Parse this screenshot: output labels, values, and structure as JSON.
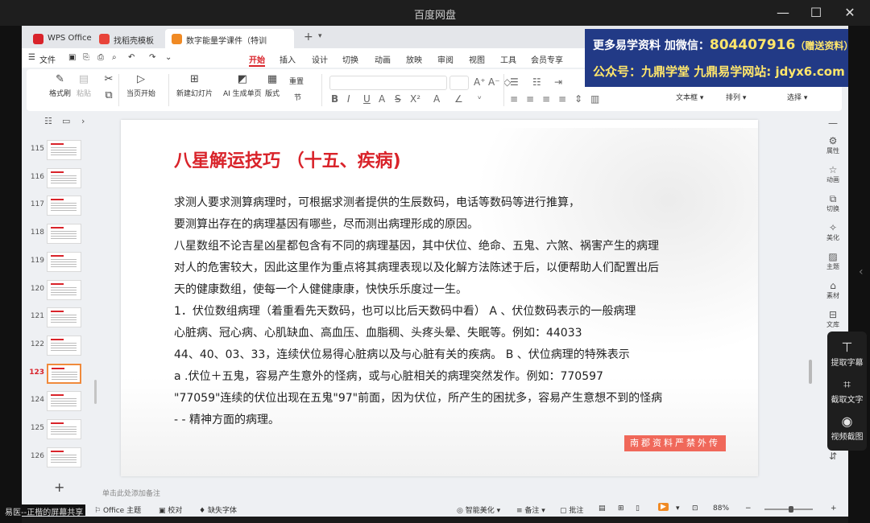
{
  "window": {
    "title": "百度网盘"
  },
  "tabs": [
    {
      "label": "WPS Office",
      "color": "#d9232a"
    },
    {
      "label": "找稻壳模板",
      "color": "#e8443a"
    },
    {
      "label": "数字能量学课件（特训营）.p",
      "color": "#f08a24"
    }
  ],
  "menubar": {
    "file": "文件",
    "items": [
      "开始",
      "插入",
      "设计",
      "切换",
      "动画",
      "放映",
      "审阅",
      "视图",
      "工具",
      "会员专享"
    ],
    "active": "开始"
  },
  "ribbon": {
    "format_painter": "格式刷",
    "paste": "粘贴",
    "start_from_current": "当页开始",
    "new_slide": "新建幻灯片",
    "ai_page": "AI 生成单页",
    "layout": "版式",
    "section": "节",
    "reset": "重置",
    "textbox": "文本框",
    "arrange": "排列",
    "select": "选择"
  },
  "ad_banner": {
    "line1_prefix": "更多易学资料 加微信：",
    "line1_number": "804407916",
    "line1_suffix": "（赠送资料）",
    "line2": "公众号：九鼎学堂 九鼎易学网站: jdyx6.com"
  },
  "thumbnails": {
    "pages": [
      "115",
      "116",
      "117",
      "118",
      "119",
      "120",
      "121",
      "122",
      "123",
      "124",
      "125",
      "126"
    ],
    "active": "123",
    "add": "+"
  },
  "slide": {
    "title": "八星解运技巧 （十五、疾病)",
    "lines": [
      "求测人要求测算病理时，可根据求测者提供的生辰数码，电话等数码等进行推算，",
      "要测算出存在的病理基因有哪些，尽而测出病理形成的原因。",
      "八星数组不论吉星凶星都包含有不同的病理基因，其中伏位、绝命、五鬼、六煞、祸害产生的病理",
      "对人的危害较大，因此这里作为重点将其病理表现以及化解方法陈述于后，以便帮助人们配置出后",
      "天的健康数组，使每一个人健健康康，快快乐乐度过一生。",
      "1．伏位数组病理（着重看先天数码，也可以比后天数码中看） A 、伏位数码表示的一般病理",
      "心脏病、冠心病、心肌缺血、高血压、血脂稠、头疼头晕、失眠等。例如：44033",
      "44、40、03、33，连续伏位易得心脏病以及与心脏有关的疾病。 B 、伏位病理的特殊表示",
      "a .伏位＋五鬼，容易产生意外的怪病，或与心脏相关的病理突然发作。例如：770597",
      "\"77059\"连续的伏位出现在五鬼\"97\"前面，因为伏位，所产生的困扰多，容易产生意想不到的怪病",
      " - - 精神方面的病理。"
    ],
    "stamp": "南郡资料严禁外传"
  },
  "right_panel": [
    "属性",
    "动画",
    "切换",
    "美化",
    "主题",
    "素材",
    "文库"
  ],
  "notes_placeholder": "单击此处添加备注",
  "statusbar": {
    "theme": "Office 主题",
    "proof": "校对",
    "missing_font": "缺失字体",
    "smart_beautify": "智能美化",
    "notes": "备注",
    "comments": "批注",
    "zoom": "88%"
  },
  "overlay_tools": [
    "提取字幕",
    "截取文字",
    "视频截图"
  ],
  "share_badge": "易医--正楷的屏幕共享"
}
